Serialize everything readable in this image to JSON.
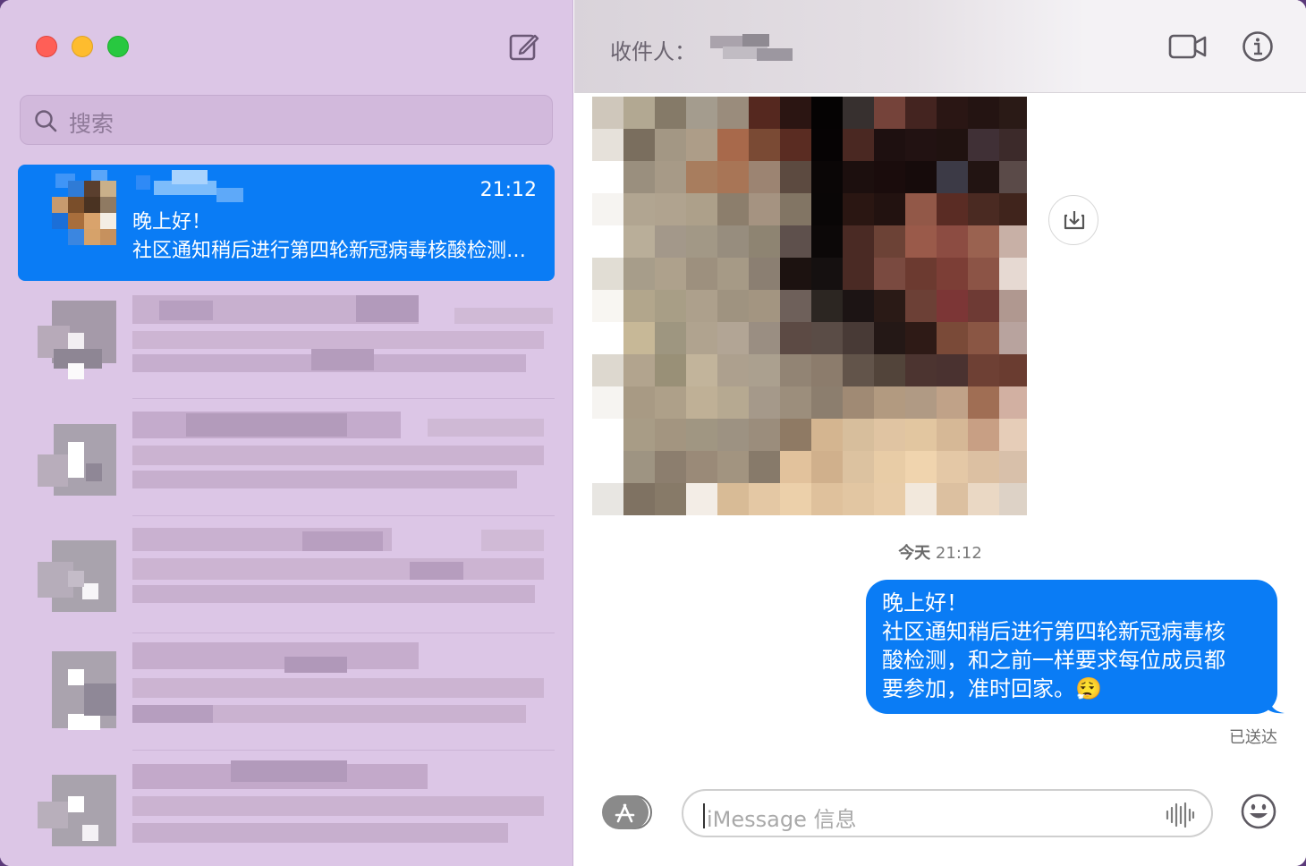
{
  "sidebar": {
    "search": {
      "placeholder": "搜索",
      "icon": "search-icon"
    },
    "selected_conversation": {
      "time": "21:12",
      "line1": "晚上好！",
      "line2": "社区通知稍后进行第四轮新冠病毒核酸检测，和之前一样要求每位成员都要参加，准时回家。"
    }
  },
  "chat": {
    "header": {
      "recipient_label": "收件人："
    },
    "timestamp": {
      "day": "今天",
      "time": "21:12"
    },
    "message": {
      "line1": "晚上好！",
      "line2": "社区通知稍后进行第四轮新冠病毒核",
      "line3": "酸检测，和之前一样要求每位成员都",
      "line4": "要参加，准时回家。",
      "emoji": "😮‍💨"
    },
    "status": "已送达",
    "input": {
      "placeholder": "iMessage 信息"
    }
  },
  "colors": {
    "accent": "#0a7cf5",
    "sidebar_bg": "#dcc6e6"
  }
}
